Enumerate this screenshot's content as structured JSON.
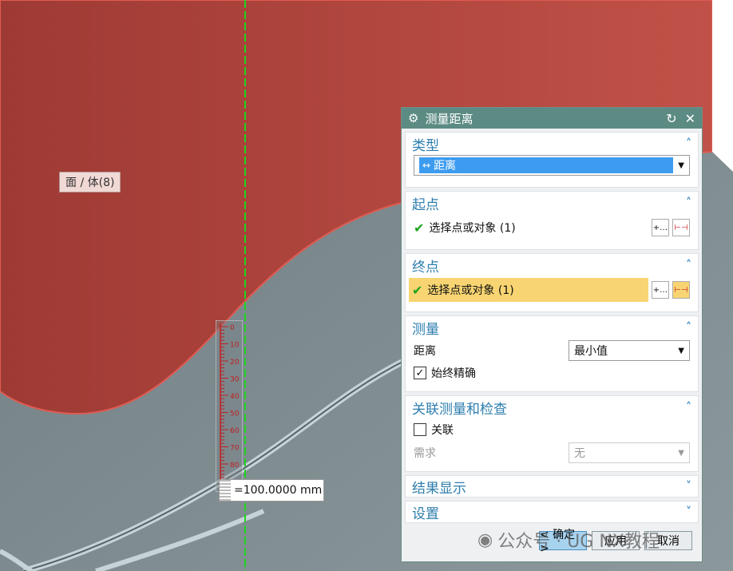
{
  "viewport": {
    "face_label": "面 / 体(8)",
    "ruler_ticks": [
      "0",
      "10",
      "20",
      "30",
      "40",
      "50",
      "60",
      "70",
      "80"
    ],
    "result_value": "=100.0000 mm"
  },
  "dialog": {
    "title": "测量距离",
    "sections": {
      "type": {
        "header": "类型",
        "selected": "距离"
      },
      "start": {
        "header": "起点",
        "select_label": "选择点或对象 (1)"
      },
      "end": {
        "header": "终点",
        "select_label": "选择点或对象 (1)"
      },
      "measure": {
        "header": "测量",
        "distance_label": "距离",
        "distance_value": "最小值",
        "always_exact_label": "始终精确",
        "always_exact_checked": true
      },
      "associative": {
        "header": "关联测量和检查",
        "associate_label": "关联",
        "requirement_label": "需求",
        "requirement_value": "无"
      },
      "results": {
        "header": "结果显示"
      },
      "settings": {
        "header": "设置"
      }
    },
    "buttons": {
      "ok": "< 确定 >",
      "apply": "应用",
      "cancel": "取消"
    }
  },
  "watermark": "公众号 · UG NX教程",
  "colors": {
    "body_red": "#b2473f",
    "title_bar": "#5c8b84",
    "header_text": "#2d7eae",
    "active_row": "#f8d572"
  }
}
